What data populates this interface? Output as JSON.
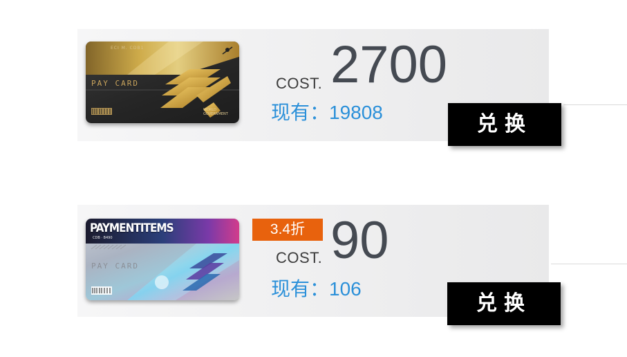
{
  "items": [
    {
      "card": {
        "label": "PAY CARD",
        "topline": "ECI M. CDB1",
        "org": "WORLD\nGOVERNMENT",
        "style": "gold",
        "icon": "gold-pay-card-icon"
      },
      "cost_label": "COST.",
      "cost_value": "2700",
      "owned_text": "现有：19808",
      "button_label": "兑换"
    },
    {
      "card": {
        "brand": "PAYMENTITEMS",
        "sub": "CDB · B490",
        "label": "PAY CARD",
        "style": "holographic",
        "icon": "holo-pay-card-icon"
      },
      "discount": "3.4折",
      "cost_label": "COST.",
      "cost_value": "90",
      "owned_text": "现有：106",
      "button_label": "兑换"
    }
  ],
  "colors": {
    "owned_text": "#2b90d9",
    "cost_value": "#454a52",
    "discount_bg": "#e8620d",
    "button_bg": "#000000",
    "panel_bg": "#eeeeef"
  }
}
